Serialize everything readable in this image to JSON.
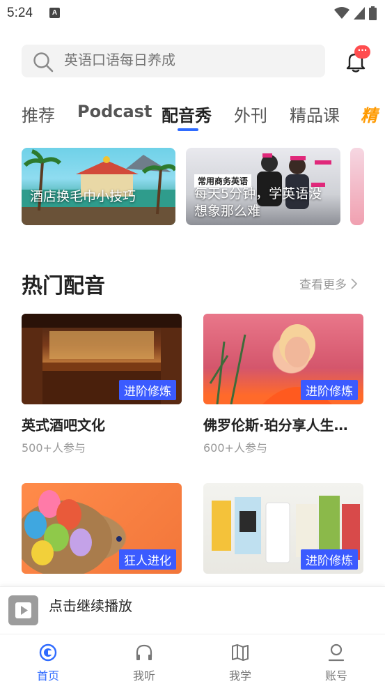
{
  "status_bar": {
    "time": "5:24",
    "notification_letter": "A"
  },
  "search": {
    "placeholder": "英语口语每日养成"
  },
  "notifications": {
    "badge": "···"
  },
  "tabs": [
    {
      "label": "推荐"
    },
    {
      "label": "Podcast"
    },
    {
      "label": "配音秀"
    },
    {
      "label": "外刊"
    },
    {
      "label": "精品课"
    },
    {
      "label": "精"
    }
  ],
  "banners": [
    {
      "caption": "酒店换毛巾小技巧"
    },
    {
      "tag": "常用商务英语",
      "caption": "每天5分钟，学英语没想象那么难"
    }
  ],
  "section": {
    "title": "热门配音",
    "more": "查看更多"
  },
  "cards": [
    {
      "title": "英式酒吧文化",
      "participants": "500+人参与",
      "badge": "进阶修炼"
    },
    {
      "title": "佛罗伦斯·珀分享人生…",
      "participants": "600+人参与",
      "badge": "进阶修炼"
    },
    {
      "title": "",
      "participants": "",
      "badge": "狂人进化"
    },
    {
      "title": "",
      "participants": "",
      "badge": "进阶修炼"
    }
  ],
  "player": {
    "text": "点击继续播放"
  },
  "bottom_nav": [
    {
      "label": "首页",
      "active": true
    },
    {
      "label": "我听"
    },
    {
      "label": "我学"
    },
    {
      "label": "账号"
    }
  ],
  "colors": {
    "accent": "#2f6bff",
    "badge_bg": "#3b5bff",
    "promo": "#ff9a00",
    "notification": "#ff4d4f"
  }
}
